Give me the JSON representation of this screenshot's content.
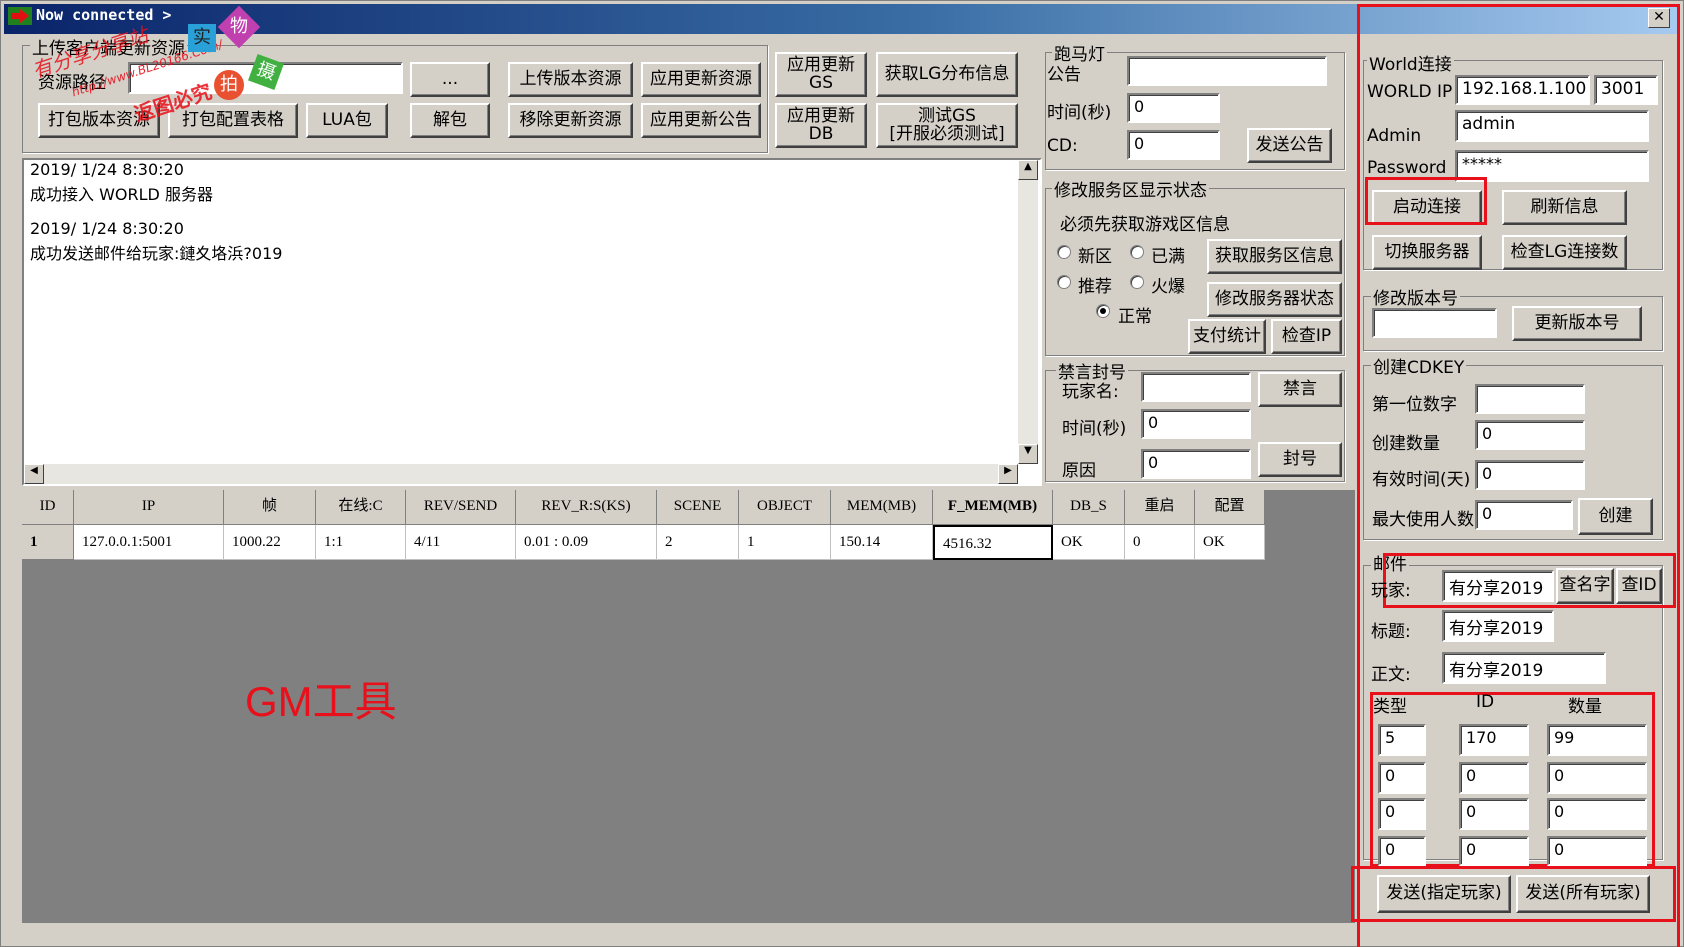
{
  "window": {
    "title": "Now connected >",
    "close_glyph": "✕"
  },
  "upload": {
    "group_label": "上传客户端更新资源",
    "path_label": "资源路径",
    "path_value": "",
    "browse_label": "...",
    "upload_version": "上传版本资源",
    "apply_resource": "应用更新资源",
    "pack_version": "打包版本资源",
    "pack_config": "打包配置表格",
    "lua_pack": "LUA包",
    "unpack": "解包",
    "remove_resource": "移除更新资源",
    "apply_notice": "应用更新公告",
    "apply_gs": "应用更新\nGS",
    "get_lg": "获取LG分布信息",
    "apply_db": "应用更新\nDB",
    "test_gs": "测试GS\n[开服必须测试]"
  },
  "marquee": {
    "group_label": "跑马灯",
    "notice_label": "公告",
    "notice_value": "",
    "time_label": "时间(秒)",
    "time_value": "0",
    "cd_label": "CD:",
    "cd_value": "0",
    "send_label": "发送公告"
  },
  "log": {
    "lines": [
      "2019/ 1/24  8:30:20",
      "成功接入 WORLD 服务器",
      "",
      "2019/ 1/24  8:30:20",
      "成功发送邮件给玩家:鏈夊垎浜?019"
    ]
  },
  "server_status": {
    "group_label": "修改服务区显示状态",
    "hint": "必须先获取游戏区信息",
    "opt_new": "新区",
    "opt_full": "已满",
    "opt_recommend": "推荐",
    "opt_hot": "火爆",
    "opt_normal": "正常",
    "get_info": "获取服务区信息",
    "modify_status": "修改服务器状态",
    "pay_stats": "支付统计",
    "check_ip": "检查IP"
  },
  "ban": {
    "group_label": "禁言封号",
    "player_label": "玩家名:",
    "player_value": "",
    "mute_label": "禁言",
    "time_label": "时间(秒)",
    "time_value": "0",
    "reason_label": "原因",
    "reason_value": "0",
    "ban_label": "封号"
  },
  "table": {
    "headers": [
      "ID",
      "IP",
      "帧",
      "在线:C",
      "REV/SEND",
      "REV_R:S(KS)",
      "SCENE",
      "OBJECT",
      "MEM(MB)",
      "F_MEM(MB)",
      "DB_S",
      "重启",
      "配置"
    ],
    "rows": [
      [
        "1",
        "127.0.0.1:5001",
        "1000.22",
        "1:1",
        "4/11",
        "0.01 : 0.09",
        "2",
        "1",
        "150.14",
        "4516.32",
        "OK",
        "0",
        "OK"
      ]
    ]
  },
  "annotation": {
    "text": "GM工具",
    "color": "#e8101a"
  },
  "watermark": {
    "line1": "有分享分享站",
    "line2": "http://www.BL20166.Com/",
    "line3": "返图必究",
    "badges": [
      "实",
      "物",
      "拍",
      "摄"
    ]
  },
  "world": {
    "group_label": "World连接",
    "ip_label": "WORLD IP",
    "ip_value": "192.168.1.100",
    "port_value": "3001",
    "admin_label": "Admin",
    "admin_value": "admin",
    "password_label": "Password",
    "password_value": "*****",
    "connect_label": "启动连接",
    "refresh_label": "刷新信息",
    "switch_label": "切换服务器",
    "check_lg_label": "检查LG连接数"
  },
  "version": {
    "group_label": "修改版本号",
    "value": "",
    "update_label": "更新版本号"
  },
  "cdkey": {
    "group_label": "创建CDKEY",
    "first_digit_label": "第一位数字",
    "first_digit_value": "",
    "count_label": "创建数量",
    "count_value": "0",
    "valid_label": "有效时间(天)",
    "valid_value": "0",
    "max_users_label": "最大使用人数",
    "max_users_value": "0",
    "create_label": "创建"
  },
  "mail": {
    "group_label": "邮件",
    "player_label": "玩家:",
    "player_value": "有分享2019",
    "find_name": "查名字",
    "find_id": "查ID",
    "title_label": "标题:",
    "title_value": "有分享2019",
    "body_label": "正文:",
    "body_value": "有分享2019",
    "col_type": "类型",
    "col_id": "ID",
    "col_qty": "数量",
    "items": [
      [
        "5",
        "170",
        "99"
      ],
      [
        "0",
        "0",
        "0"
      ],
      [
        "0",
        "0",
        "0"
      ],
      [
        "0",
        "0",
        "0"
      ]
    ],
    "send_player": "发送(指定玩家)",
    "send_all": "发送(所有玩家)"
  }
}
